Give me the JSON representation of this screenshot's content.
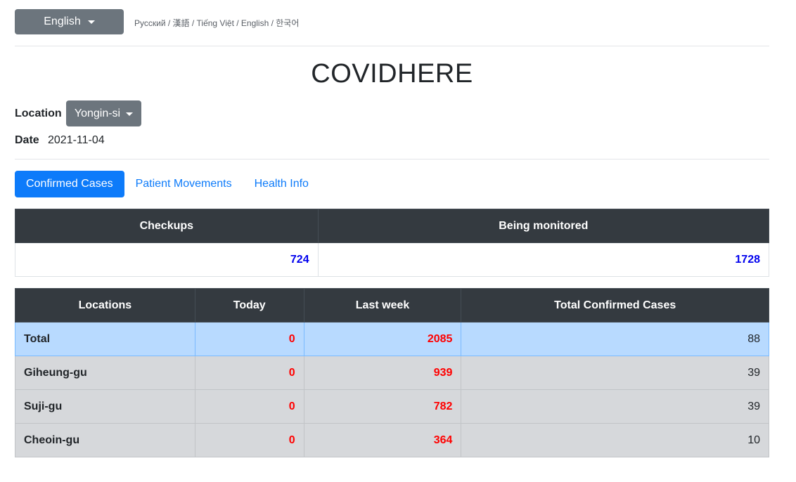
{
  "language": {
    "selected": "English",
    "links": "Русский / 漢語 / Tiếng Việt / English / 한국어"
  },
  "title": "COVIDHERE",
  "location": {
    "label": "Location",
    "selected": "Yongin-si"
  },
  "date": {
    "label": "Date",
    "value": "2021-11-04"
  },
  "tabs": [
    "Confirmed Cases",
    "Patient Movements",
    "Health Info"
  ],
  "summary": {
    "headers": [
      "Checkups",
      "Being monitored"
    ],
    "values": [
      "724",
      "1728"
    ]
  },
  "cases": {
    "headers": [
      "Locations",
      "Today",
      "Last week",
      "Total Confirmed Cases"
    ],
    "rows": [
      {
        "location": "Total",
        "today": "0",
        "last_week": "2085",
        "total": "88"
      },
      {
        "location": "Giheung-gu",
        "today": "0",
        "last_week": "939",
        "total": "39"
      },
      {
        "location": "Suji-gu",
        "today": "0",
        "last_week": "782",
        "total": "39"
      },
      {
        "location": "Cheoin-gu",
        "today": "0",
        "last_week": "364",
        "total": "10"
      }
    ]
  },
  "colors": {
    "secondary": "#6c757d",
    "primary": "#0d7bfa",
    "header_dark": "#343a40",
    "total_row": "#b8daff",
    "row_gray": "#d6d8db",
    "red_value": "#ff0000",
    "blue_value": "#0000ee"
  },
  "icons": {
    "dropdown": "caret-down-icon"
  }
}
